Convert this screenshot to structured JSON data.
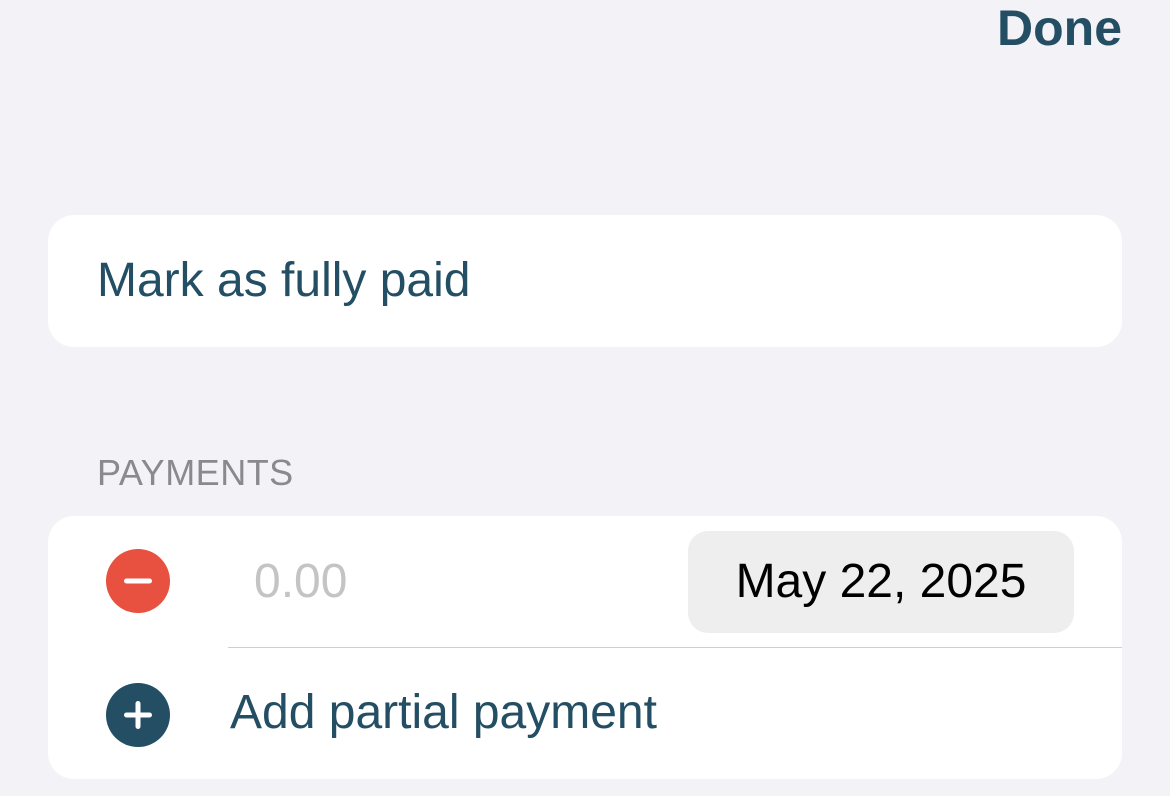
{
  "nav": {
    "done_label": "Done"
  },
  "actions": {
    "mark_paid_label": "Mark as fully paid"
  },
  "payments": {
    "section_title": "PAYMENTS",
    "items": [
      {
        "amount_placeholder": "0.00",
        "amount_value": "",
        "date": "May 22, 2025",
        "remove_icon": "minus-circle-icon"
      }
    ],
    "add_label": "Add partial payment",
    "add_icon": "plus-circle-icon"
  },
  "colors": {
    "background": "#f2f2f7",
    "accent": "#234e63",
    "destructive": "#e8503f",
    "section_header": "#8a8a8e",
    "placeholder": "#c4c4c6",
    "date_pill": "#eeeeef"
  }
}
